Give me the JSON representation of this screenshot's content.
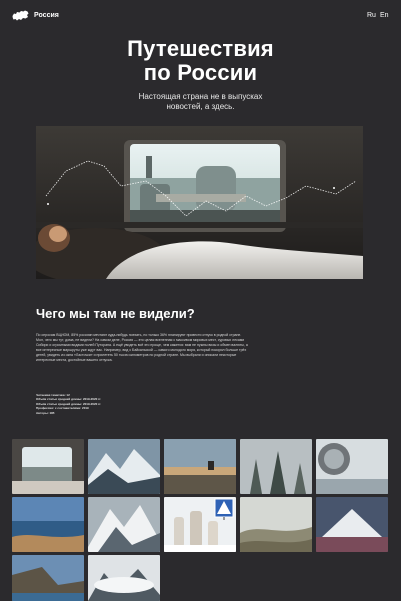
{
  "header": {
    "brand": "Россия",
    "lang_ru": "Ru",
    "lang_en": "En"
  },
  "hero": {
    "title_line1": "Путешествия",
    "title_line2": "по России",
    "subtitle": "Настоящая страна не в выпусках новостей, а здесь."
  },
  "section": {
    "title": "Чего мы там не видели?",
    "body": "По опросам ВЦИОМ, 85% россиян мечтают куда-нибудь поехать, но только 36% планируют провести отпуск в родной стране. Мол, чего мы тут, дома, не видели? На самом деле, Россия — это целая вселенная с массивом мировых мест, суровых лесами Сибири и огромными видами полей Путорана. А ещё увидеть всё это проще, чем кажется: вам не нужны визы и обмен валюты, а все интересные маршруты уже ждут вас. Например, вид с Байкальской — самого молодого моря, который покорил больше трёх детей, увидеть из окна «Ласточки» и прилететь 50 тысяч километров по родной стране. Мы выбрали и описали некоторые интересные места, достойные вашего отпуска.",
    "notes": [
      "Читаемая тематика: 12",
      "Объём статьи средней длины: 2019-2020 гг.",
      "Объём статьи средней длины: 2019-2020 гг.",
      "Профессии: с составителями: 2019",
      "Авторы: 185"
    ]
  },
  "gallery": {
    "photos": [
      "train-window-photo",
      "snowy-mountains-photo",
      "sunset-reindeer-photo",
      "foggy-forest-photo",
      "frozen-window-photo",
      "lake-shore-photo",
      "snowy-peaks-photo",
      "rock-pillars-photo",
      "pedestrian-sign-photo",
      "misty-hills-photo",
      "volcano-photo",
      "coastal-cliffs-photo",
      "cloudy-peaks-photo"
    ]
  },
  "colors": {
    "background": "#2b2a2d",
    "text": "#ffffff"
  }
}
